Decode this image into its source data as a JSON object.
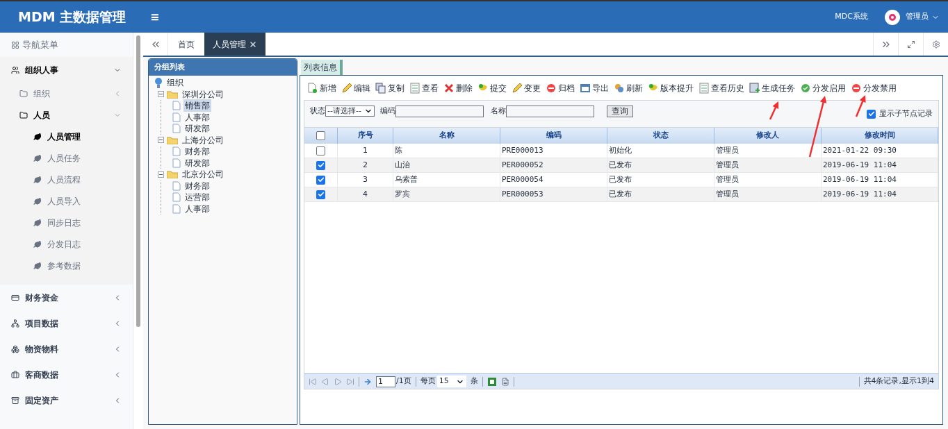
{
  "header": {
    "logo": "MDM 主数据管理",
    "menu_toggle": "≡",
    "system_link": "MDC系统",
    "user": "管理员"
  },
  "sidebar": {
    "title": "导航菜单",
    "groups": [
      {
        "label": "组织人事",
        "expanded": true,
        "children": [
          {
            "label": "组织",
            "expanded": false
          },
          {
            "label": "人员",
            "expanded": true,
            "children": [
              {
                "label": "人员管理",
                "selected": true
              },
              {
                "label": "人员任务",
                "selected": false
              },
              {
                "label": "人员流程",
                "selected": false
              },
              {
                "label": "人员导入",
                "selected": false
              },
              {
                "label": "同步日志",
                "selected": false
              },
              {
                "label": "分发日志",
                "selected": false
              },
              {
                "label": "参考数据",
                "selected": false
              }
            ]
          }
        ]
      },
      {
        "label": "财务资金",
        "expanded": false
      },
      {
        "label": "项目数据",
        "expanded": false
      },
      {
        "label": "物资物料",
        "expanded": false
      },
      {
        "label": "客商数据",
        "expanded": false
      },
      {
        "label": "固定资产",
        "expanded": false
      }
    ]
  },
  "tabs": [
    {
      "label": "首页",
      "selected": false,
      "closable": false
    },
    {
      "label": "人员管理",
      "selected": true,
      "closable": true
    }
  ],
  "group_panel": {
    "title": "分组列表",
    "tree": {
      "label": "组织",
      "selected": false,
      "children": [
        {
          "label": "深圳分公司",
          "selected": false,
          "children": [
            {
              "label": "销售部",
              "selected": true
            },
            {
              "label": "人事部",
              "selected": false
            },
            {
              "label": "研发部",
              "selected": false
            }
          ]
        },
        {
          "label": "上海分公司",
          "selected": false,
          "children": [
            {
              "label": "财务部",
              "selected": false
            },
            {
              "label": "研发部",
              "selected": false
            }
          ]
        },
        {
          "label": "北京分公司",
          "selected": false,
          "children": [
            {
              "label": "财务部",
              "selected": false
            },
            {
              "label": "运营部",
              "selected": false
            },
            {
              "label": "人事部",
              "selected": false
            }
          ]
        }
      ]
    }
  },
  "list_panel": {
    "tab": "列表信息",
    "toolbar": [
      "新增",
      "编辑",
      "复制",
      "查看",
      "删除",
      "提交",
      "变更",
      "归档",
      "导出",
      "刷新",
      "版本提升",
      "查看历史",
      "生成任务",
      "分发启用",
      "分发禁用"
    ],
    "filters": {
      "status_label": "状态",
      "status_value": "--请选择--",
      "code_label": "编码",
      "name_label": "名称",
      "query_button": "查询",
      "show_children": {
        "label": "显示子节点记录",
        "checked": true
      }
    },
    "table": {
      "columns": [
        "序号",
        "名称",
        "编码",
        "状态",
        "修改人",
        "修改时间"
      ],
      "header_checked": false,
      "rows": [
        {
          "checked": false,
          "cells": [
            "1",
            "陈",
            "PRE000013",
            "初始化",
            "管理员",
            "2021-01-22 09:30"
          ]
        },
        {
          "checked": true,
          "cells": [
            "2",
            "山治",
            "PER000052",
            "已发布",
            "管理员",
            "2019-06-19 11:04"
          ]
        },
        {
          "checked": true,
          "cells": [
            "3",
            "乌索普",
            "PER000054",
            "已发布",
            "管理员",
            "2019-06-19 11:04"
          ]
        },
        {
          "checked": true,
          "cells": [
            "4",
            "罗宾",
            "PER000053",
            "已发布",
            "管理员",
            "2019-06-19 11:04"
          ]
        }
      ]
    },
    "pager": {
      "page": "1",
      "page_total": "/1页",
      "per_page_label": "每页",
      "per_page": "15",
      "unit": "条",
      "summary": "共4条记录,显示1到4"
    }
  }
}
